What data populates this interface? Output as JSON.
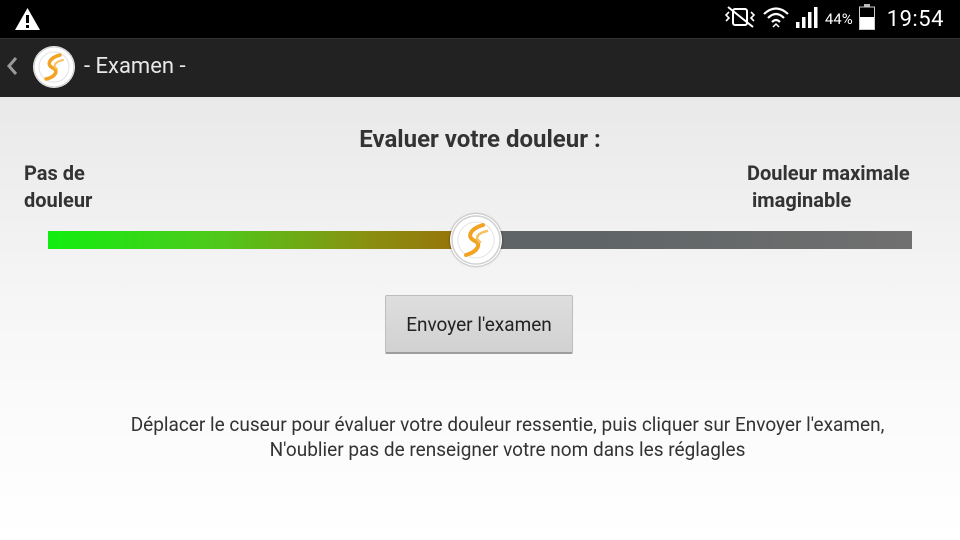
{
  "status_bar": {
    "battery_percent": "44%",
    "time": "19:54",
    "icons": [
      "warning-icon",
      "vibrate-mute-icon",
      "wifi-icon",
      "signal-icon",
      "battery-icon"
    ]
  },
  "action_bar": {
    "back_icon": "chevron-left-icon",
    "title": "- Examen -"
  },
  "main": {
    "heading": "Evaluer votre douleur :",
    "min_label_line1": "Pas de",
    "min_label_line2": "douleur",
    "max_label_line1": "Douleur maximale",
    "max_label_line2": "imaginable",
    "slider_value": 0.5,
    "send_button": "Envoyer l'examen",
    "instructions_line1": "Déplacer le cuseur pour évaluer votre douleur ressentie, puis cliquer sur Envoyer l'examen,",
    "instructions_line2": "N'oublier pas de renseigner votre nom dans les réglagles"
  },
  "colors": {
    "statusbar": "#000000",
    "actionbar": "#222222",
    "slider_fill_start": "#11ee11",
    "slider_fill_end": "#9a6e08",
    "slider_track": "#5f6466",
    "logo_orange": "#f2a321"
  }
}
